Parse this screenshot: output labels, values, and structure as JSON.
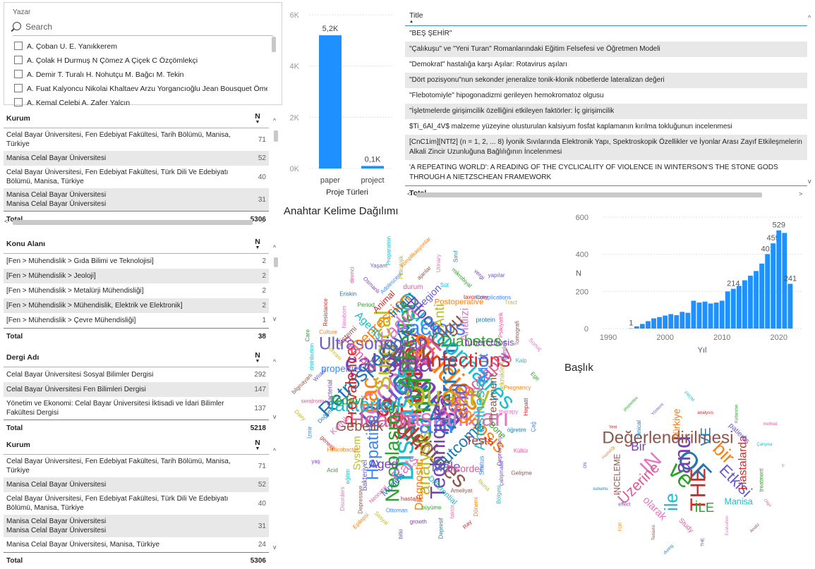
{
  "yazar_slicer": {
    "header": "Yazar",
    "search_placeholder": "Search",
    "items": [
      "A. Çoban U. E. Yanıkkerem",
      "A. Çolak H Durmuş N Çömez A Çiçek C Özçömlekçi",
      "A. Demir T. Turalı H. Nohutçu M. Bağcı M. Tekin",
      "A. Fuat Kalyoncu Nikolai Khaltaev Arzu Yorgancıoğlu Jean Bousquet Ömer Kalaycı",
      "A. Kemal Celebi A. Zafer Yalcın"
    ]
  },
  "kurum_table_1": {
    "col1": "Kurum",
    "col2": "N",
    "rows": [
      {
        "name": "Celal Bayar Üniversitesi, Fen Edebiyat Fakültesi, Tarih Bölümü, Manisa, Türkiye",
        "n": "71"
      },
      {
        "name": "Manisa Celal Bayar Üniversitesi",
        "n": "52"
      },
      {
        "name": "Celal Bayar Üniversitesi, Fen Edebiyat Fakültesi, Türk Dili Ve Edebiyatı Bölümü, Manisa, Türkiye",
        "n": "40"
      },
      {
        "name": "Manisa Celal Bayar Üniversitesi\nManisa Celal Bayar Üniversitesi",
        "n": "31"
      }
    ],
    "total_label": "Total",
    "total": "5306"
  },
  "konu_table": {
    "col1": "Konu Alanı",
    "col2": "N",
    "rows": [
      {
        "name": "[Fen > Mühendislik > Gıda Bilimi ve Teknolojisi]",
        "n": "2"
      },
      {
        "name": "[Fen > Mühendislik > Jeoloji]",
        "n": "2"
      },
      {
        "name": "[Fen > Mühendislik > Metalürji Mühendisliği]",
        "n": "2"
      },
      {
        "name": "[Fen > Mühendislik > Mühendislik, Elektrik ve Elektronik]",
        "n": "2"
      },
      {
        "name": "[Fen > Mühendislik > Çevre Mühendisliği]",
        "n": "1"
      }
    ],
    "total_label": "Total",
    "total": "38"
  },
  "dergi_table": {
    "col1": "Dergi Adı",
    "col2": "N",
    "rows": [
      {
        "name": "Celal Bayar Üniversitesi Sosyal Bilimler Dergisi",
        "n": "292"
      },
      {
        "name": "Celal Bayar Üniversitesi Fen Bilimleri Dergisi",
        "n": "147"
      },
      {
        "name": "Yönetim ve Ekonomi: Celal Bayar Üniversitesi İktisadi ve İdari Bilimler Fakültesi Dergisi",
        "n": "137"
      }
    ],
    "total_label": "Total",
    "total": "5218"
  },
  "kurum_table_2": {
    "col1": "Kurum",
    "col2": "N",
    "rows": [
      {
        "name": "Celal Bayar Üniversitesi, Fen Edebiyat Fakültesi, Tarih Bölümü, Manisa, Türkiye",
        "n": "71"
      },
      {
        "name": "Manisa Celal Bayar Üniversitesi",
        "n": "52"
      },
      {
        "name": "Celal Bayar Üniversitesi, Fen Edebiyat Fakültesi, Türk Dili Ve Edebiyatı Bölümü, Manisa, Türkiye",
        "n": "40"
      },
      {
        "name": "Manisa Celal Bayar Üniversitesi\nManisa Celal Bayar Üniversitesi",
        "n": "31"
      },
      {
        "name": "Manisa Celal Bayar Üniversitesi, Manisa, Türkiye",
        "n": "24"
      }
    ],
    "total_label": "Total",
    "total": "5306"
  },
  "title_table": {
    "header": "Title",
    "rows": [
      "\"BEŞ ŞEHİR\"",
      "\"Çalıkuşu\" ve \"Yeni Turan\" Romanlarındaki Eğitim Felsefesi ve Öğretmen Modeli",
      "\"Demokrat\" hastalığa karşı Aşılar: Rotavirus aşıları",
      "\"Dört pozisyonu\"nun sekonder jeneralize tonik-klonik nöbetlerde lateralizan değeri",
      "\"Flebotomiyle\" hipogonadizmi gerileyen hemokromatoz olgusu",
      "\"İşletmelerde girişimcilik özelliğini etkileyen faktörler: İç girişimcilik",
      "$Ti_6Al_4V$ malzeme yüzeyine olusturulan kalsiyum fosfat kaplamanın kırılma tokluğunun incelenmesi",
      "[CnC1im][NTf2] (n = 1, 2, ... 8) İyonik Sıvılarında Elektronik Yapı, Spektroskopik Özellikler ve İyonlar Arası Zayıf Etkileşmelerin Alkali Zincir Uzunluğuna Bağlılığının İncelenmesi",
      "'A REPEATING WORLD': A READING OF THE CYCLICALITY OF VIOLENCE IN WINTERSON'S THE STONE GODS THROUGH A NIETZSCHEAN FRAMEWORK"
    ],
    "total_label": "Total"
  },
  "proje_chart_title": "Proje Türleri",
  "anahtar_title": "Anahtar Kelime Dağılımı",
  "baslik_title": "Başlık",
  "wordcloud_keywords": [
    "Manisa",
    "Türkiye",
    "Turkey",
    "Child",
    "Çocuk",
    "Studies",
    "Diseases",
    "Risk",
    "Quality",
    "Drug",
    "Of",
    "Tanı",
    "çalışma",
    "Cerrahi",
    "Sağlık",
    "Anketler",
    "hastalıkları",
    "İlaç",
    "Questionnaires",
    "Procedures",
    "Surgical",
    "and",
    "Health",
    "Factors",
    "Techniques",
    "Retrospective",
    "Infections",
    "Neoplasms",
    "Kadın",
    "Diagnosis",
    "faktörleri",
    "Olgu",
    "analysis",
    "Ultrasonografi",
    "Tomography",
    "Hepatitis",
    "Blood",
    "Outcome",
    "Prevalence",
    "Diabetes",
    "Rats",
    "Depression",
    "Anesthesia",
    "Gebelik",
    "Anti",
    "Male",
    "Female",
    "Adult",
    "Aged",
    "Infant",
    "Tests",
    "Tedavi",
    "Analizi",
    "Diagnostic",
    "Agents",
    "Treatment",
    "System",
    "Region",
    "Disorder",
    "properties",
    "tuberculosis",
    "Models",
    "Animal",
    "Bone",
    "Kemik",
    "Postoperative",
    "Differential",
    "sistemi",
    "teknikleri",
    "bakteriyel",
    "durum",
    "Status",
    "Bacterial",
    "protein",
    "hastalık",
    "Period",
    "therapy",
    "Helicobacter",
    "Süt",
    "Ameliyat",
    "sonrası",
    "işlemleri",
    "Neonatal",
    "Adolescent",
    "Depresyon",
    "Doğum",
    "taxonomy",
    "büyüme",
    "Newborn",
    "Pregnancy",
    "eğitim",
    "ajanlar",
    "fauna",
    "Wistar",
    "Psikiyatrik",
    "Ottoman",
    "Osmanlı",
    "öğretim",
    "genetik",
    "mikrobiyal",
    "faktör",
    "Culture",
    "Kalp",
    "Depressive",
    "Psikolojik",
    "çalışmalar",
    "sendromu",
    "Complications",
    "growth",
    "Eriskin",
    "Hepatit",
    "Acid",
    "Urinary",
    "Dönemi",
    "distribution",
    "Tomografi",
    "Sosyal",
    "Yaşam",
    "Kültür",
    "İzmir",
    "vergi",
    "Depresif",
    "Resistance",
    "Ege",
    "Disorders",
    "komplikasyonlar",
    "Bölgesi",
    "bilgisayarlı",
    "Tract",
    "bitki",
    "direnci",
    "Çağ",
    "yaş",
    "Sınıf",
    "Ray",
    "Care",
    "Sonuç",
    "Epilepsi",
    "Preparation",
    "Gelişme",
    "Dairy",
    "yapılar"
  ],
  "wordcloud_titles": [
    "OF",
    "ve",
    "and",
    "THE",
    "IN",
    "bir",
    "ile",
    "Değerlendirilmesi",
    "Etkisi",
    "Üzerine",
    "VE",
    "İLE",
    "Bir",
    "Hastalarda",
    "olarak",
    "Türkiye",
    "Manisa",
    "INCELEME",
    "patients",
    "Study",
    "clinical",
    "treatment",
    "effect",
    "analysis",
    "Evaluation",
    "Hastalığı",
    "Çalışma",
    "Tedavisi",
    "Yöntemi",
    "Olgu",
    "sunumu",
    "Kullanılan",
    "THE",
    "Yeni",
    "A",
    "FOR",
    "FROM",
    "Analiz",
    "ON",
    "method",
    "during",
    "properties"
  ],
  "proje_chart_data": {
    "type": "bar",
    "categories": [
      "paper",
      "project"
    ],
    "values": [
      5200,
      100
    ],
    "data_labels": [
      "5,2K",
      "0,1K"
    ],
    "ytick_labels": [
      "0K",
      "2K",
      "4K",
      "6K"
    ],
    "ylim": [
      0,
      6000
    ],
    "title": "Proje Türleri",
    "grid": true,
    "color": "#1e90ff"
  },
  "chart_data": {
    "type": "bar",
    "x": [
      1994,
      1995,
      1996,
      1997,
      1998,
      1999,
      2000,
      2001,
      2002,
      2003,
      2004,
      2005,
      2006,
      2007,
      2008,
      2009,
      2010,
      2011,
      2012,
      2013,
      2014,
      2015,
      2016,
      2017,
      2018,
      2019,
      2020,
      2021,
      2022
    ],
    "values": [
      1,
      12,
      25,
      40,
      55,
      62,
      70,
      78,
      72,
      90,
      85,
      150,
      140,
      145,
      135,
      140,
      150,
      200,
      214,
      230,
      260,
      285,
      310,
      350,
      401,
      459,
      529,
      515,
      241
    ],
    "data_labels": {
      "1994": "1",
      "2012": "214",
      "2018": "401",
      "2019": "459",
      "2020": "529",
      "2022": "241"
    },
    "xlabel": "Yıl",
    "ylabel": "N",
    "xticks": [
      1990,
      2000,
      2010,
      2020
    ],
    "yticks": [
      0,
      200,
      400,
      600
    ],
    "xlim": [
      1989,
      2024
    ],
    "ylim": [
      0,
      600
    ],
    "grid": true,
    "color": "#1e90ff"
  }
}
